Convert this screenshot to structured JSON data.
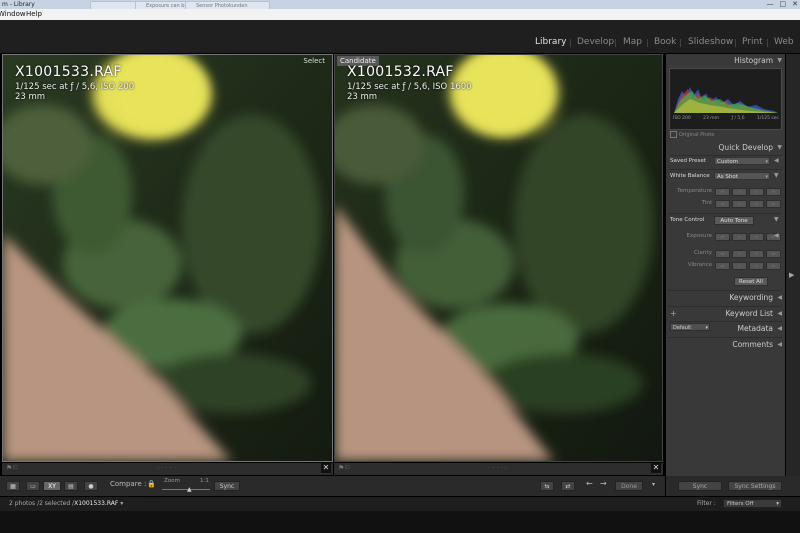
{
  "window": {
    "title": "m - Library",
    "tabs": [
      "",
      "Exposure can be tricky",
      "Sensor Photokunden"
    ]
  },
  "menu": {
    "items": [
      "Window",
      "Help"
    ]
  },
  "modules": {
    "items": [
      "Library",
      "Develop",
      "Map",
      "Book",
      "Slideshow",
      "Print",
      "Web"
    ],
    "active": "Library"
  },
  "compare": {
    "select": {
      "tag": "Select",
      "filename": "X1001533.RAF",
      "exposure": "1/125 sec at ƒ / 5,6, ISO 200",
      "focal": "23 mm"
    },
    "candidate": {
      "tag": "Candidate",
      "filename": "X1001532.RAF",
      "exposure": "1/125 sec at ƒ / 5,6, ISO 1600",
      "focal": "23 mm"
    }
  },
  "panel": {
    "histogram": {
      "title": "Histogram",
      "iso": "ISO 200",
      "focal": "23 mm",
      "aperture": "ƒ / 5,6",
      "shutter": "1/125 sec",
      "original_photo": "Original Photo"
    },
    "quick_develop": {
      "title": "Quick Develop",
      "saved_preset_label": "Saved Preset",
      "saved_preset_value": "Custom",
      "white_balance_label": "White Balance",
      "white_balance_value": "As Shot",
      "temperature": "Temperature",
      "tint": "Tint",
      "tone_control": "Tone Control",
      "auto_tone": "Auto Tone",
      "exposure": "Exposure",
      "clarity": "Clarity",
      "vibrance": "Vibrance",
      "reset_all": "Reset All"
    },
    "keywording": "Keywording",
    "keyword_list": "Keyword List",
    "keyword_list_add": "+",
    "metadata": "Metadata",
    "metadata_preset": "Default",
    "comments": "Comments"
  },
  "toolbar": {
    "compare_label": "Compare :",
    "zoom_label": "Zoom",
    "zoom_ratio": "1:1",
    "sync_label": "Sync",
    "done_label": "Done"
  },
  "right_toolbar": {
    "sync": "Sync",
    "sync_settings": "Sync Settings"
  },
  "filmstrip": {
    "count_prefix": "2 photos /2 selected /",
    "current_file": "X1001533.RAF",
    "filter_label": "Filter :",
    "filter_value": "Filters Off"
  },
  "colors": {
    "panel_bg": "#393939",
    "module_active": "#e0e0e0",
    "module_inactive": "#8a8a8a"
  }
}
